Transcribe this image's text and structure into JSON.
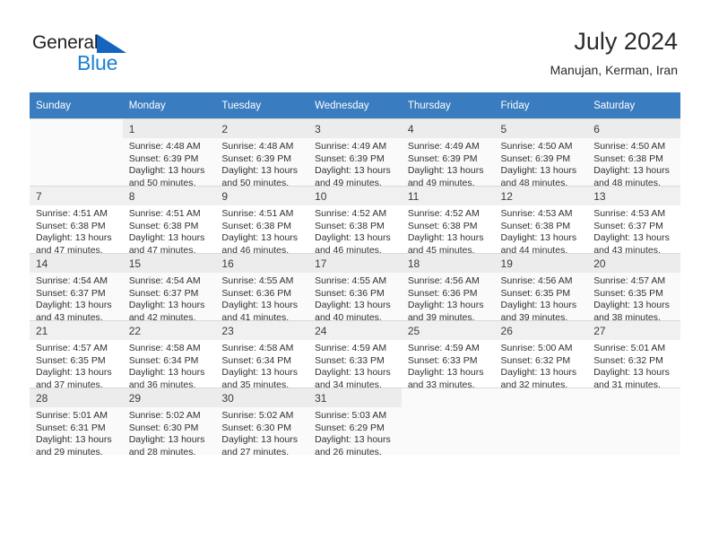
{
  "brand": {
    "name_part1": "General",
    "name_part2": "Blue",
    "accent_color": "#1b7fd4",
    "triangle_color": "#1565c0"
  },
  "header": {
    "title": "July 2024",
    "subtitle": "Manujan, Kerman, Iran"
  },
  "calendar": {
    "header_bg": "#3a7cc0",
    "weekdays": [
      "Sunday",
      "Monday",
      "Tuesday",
      "Wednesday",
      "Thursday",
      "Friday",
      "Saturday"
    ],
    "weeks": [
      [
        {
          "day": "",
          "sunrise": "",
          "sunset": "",
          "daylight": ""
        },
        {
          "day": "1",
          "sunrise": "Sunrise: 4:48 AM",
          "sunset": "Sunset: 6:39 PM",
          "daylight": "Daylight: 13 hours and 50 minutes."
        },
        {
          "day": "2",
          "sunrise": "Sunrise: 4:48 AM",
          "sunset": "Sunset: 6:39 PM",
          "daylight": "Daylight: 13 hours and 50 minutes."
        },
        {
          "day": "3",
          "sunrise": "Sunrise: 4:49 AM",
          "sunset": "Sunset: 6:39 PM",
          "daylight": "Daylight: 13 hours and 49 minutes."
        },
        {
          "day": "4",
          "sunrise": "Sunrise: 4:49 AM",
          "sunset": "Sunset: 6:39 PM",
          "daylight": "Daylight: 13 hours and 49 minutes."
        },
        {
          "day": "5",
          "sunrise": "Sunrise: 4:50 AM",
          "sunset": "Sunset: 6:39 PM",
          "daylight": "Daylight: 13 hours and 48 minutes."
        },
        {
          "day": "6",
          "sunrise": "Sunrise: 4:50 AM",
          "sunset": "Sunset: 6:38 PM",
          "daylight": "Daylight: 13 hours and 48 minutes."
        }
      ],
      [
        {
          "day": "7",
          "sunrise": "Sunrise: 4:51 AM",
          "sunset": "Sunset: 6:38 PM",
          "daylight": "Daylight: 13 hours and 47 minutes."
        },
        {
          "day": "8",
          "sunrise": "Sunrise: 4:51 AM",
          "sunset": "Sunset: 6:38 PM",
          "daylight": "Daylight: 13 hours and 47 minutes."
        },
        {
          "day": "9",
          "sunrise": "Sunrise: 4:51 AM",
          "sunset": "Sunset: 6:38 PM",
          "daylight": "Daylight: 13 hours and 46 minutes."
        },
        {
          "day": "10",
          "sunrise": "Sunrise: 4:52 AM",
          "sunset": "Sunset: 6:38 PM",
          "daylight": "Daylight: 13 hours and 46 minutes."
        },
        {
          "day": "11",
          "sunrise": "Sunrise: 4:52 AM",
          "sunset": "Sunset: 6:38 PM",
          "daylight": "Daylight: 13 hours and 45 minutes."
        },
        {
          "day": "12",
          "sunrise": "Sunrise: 4:53 AM",
          "sunset": "Sunset: 6:38 PM",
          "daylight": "Daylight: 13 hours and 44 minutes."
        },
        {
          "day": "13",
          "sunrise": "Sunrise: 4:53 AM",
          "sunset": "Sunset: 6:37 PM",
          "daylight": "Daylight: 13 hours and 43 minutes."
        }
      ],
      [
        {
          "day": "14",
          "sunrise": "Sunrise: 4:54 AM",
          "sunset": "Sunset: 6:37 PM",
          "daylight": "Daylight: 13 hours and 43 minutes."
        },
        {
          "day": "15",
          "sunrise": "Sunrise: 4:54 AM",
          "sunset": "Sunset: 6:37 PM",
          "daylight": "Daylight: 13 hours and 42 minutes."
        },
        {
          "day": "16",
          "sunrise": "Sunrise: 4:55 AM",
          "sunset": "Sunset: 6:36 PM",
          "daylight": "Daylight: 13 hours and 41 minutes."
        },
        {
          "day": "17",
          "sunrise": "Sunrise: 4:55 AM",
          "sunset": "Sunset: 6:36 PM",
          "daylight": "Daylight: 13 hours and 40 minutes."
        },
        {
          "day": "18",
          "sunrise": "Sunrise: 4:56 AM",
          "sunset": "Sunset: 6:36 PM",
          "daylight": "Daylight: 13 hours and 39 minutes."
        },
        {
          "day": "19",
          "sunrise": "Sunrise: 4:56 AM",
          "sunset": "Sunset: 6:35 PM",
          "daylight": "Daylight: 13 hours and 39 minutes."
        },
        {
          "day": "20",
          "sunrise": "Sunrise: 4:57 AM",
          "sunset": "Sunset: 6:35 PM",
          "daylight": "Daylight: 13 hours and 38 minutes."
        }
      ],
      [
        {
          "day": "21",
          "sunrise": "Sunrise: 4:57 AM",
          "sunset": "Sunset: 6:35 PM",
          "daylight": "Daylight: 13 hours and 37 minutes."
        },
        {
          "day": "22",
          "sunrise": "Sunrise: 4:58 AM",
          "sunset": "Sunset: 6:34 PM",
          "daylight": "Daylight: 13 hours and 36 minutes."
        },
        {
          "day": "23",
          "sunrise": "Sunrise: 4:58 AM",
          "sunset": "Sunset: 6:34 PM",
          "daylight": "Daylight: 13 hours and 35 minutes."
        },
        {
          "day": "24",
          "sunrise": "Sunrise: 4:59 AM",
          "sunset": "Sunset: 6:33 PM",
          "daylight": "Daylight: 13 hours and 34 minutes."
        },
        {
          "day": "25",
          "sunrise": "Sunrise: 4:59 AM",
          "sunset": "Sunset: 6:33 PM",
          "daylight": "Daylight: 13 hours and 33 minutes."
        },
        {
          "day": "26",
          "sunrise": "Sunrise: 5:00 AM",
          "sunset": "Sunset: 6:32 PM",
          "daylight": "Daylight: 13 hours and 32 minutes."
        },
        {
          "day": "27",
          "sunrise": "Sunrise: 5:01 AM",
          "sunset": "Sunset: 6:32 PM",
          "daylight": "Daylight: 13 hours and 31 minutes."
        }
      ],
      [
        {
          "day": "28",
          "sunrise": "Sunrise: 5:01 AM",
          "sunset": "Sunset: 6:31 PM",
          "daylight": "Daylight: 13 hours and 29 minutes."
        },
        {
          "day": "29",
          "sunrise": "Sunrise: 5:02 AM",
          "sunset": "Sunset: 6:30 PM",
          "daylight": "Daylight: 13 hours and 28 minutes."
        },
        {
          "day": "30",
          "sunrise": "Sunrise: 5:02 AM",
          "sunset": "Sunset: 6:30 PM",
          "daylight": "Daylight: 13 hours and 27 minutes."
        },
        {
          "day": "31",
          "sunrise": "Sunrise: 5:03 AM",
          "sunset": "Sunset: 6:29 PM",
          "daylight": "Daylight: 13 hours and 26 minutes."
        },
        {
          "day": "",
          "sunrise": "",
          "sunset": "",
          "daylight": ""
        },
        {
          "day": "",
          "sunrise": "",
          "sunset": "",
          "daylight": ""
        },
        {
          "day": "",
          "sunrise": "",
          "sunset": "",
          "daylight": ""
        }
      ]
    ]
  }
}
